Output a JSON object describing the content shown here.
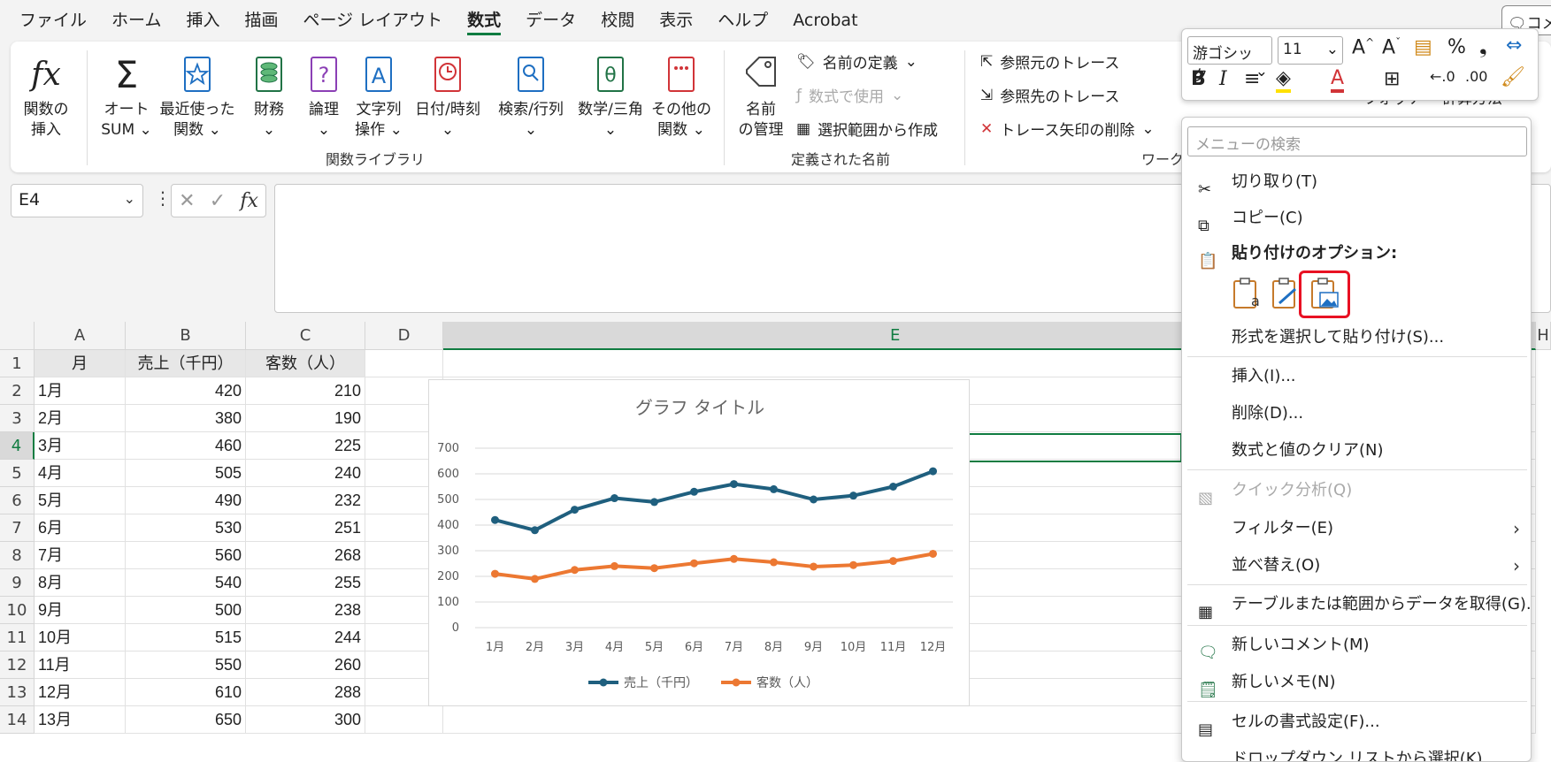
{
  "tabs": [
    "ファイル",
    "ホーム",
    "挿入",
    "描画",
    "ページ レイアウト",
    "数式",
    "データ",
    "校閲",
    "表示",
    "ヘルプ",
    "Acrobat"
  ],
  "active_tab": "数式",
  "comment_button": "コメ",
  "ribbon": {
    "insert_function": [
      "関数の",
      "挿入"
    ],
    "autosum": [
      "オート",
      "SUM ⌄"
    ],
    "recent": [
      "最近使った",
      "関数 ⌄"
    ],
    "financial": [
      "財務",
      "⌄"
    ],
    "logical": [
      "論理",
      "⌄"
    ],
    "text": [
      "文字列",
      "操作 ⌄"
    ],
    "datetime": [
      "日付/時刻",
      "⌄"
    ],
    "lookup": [
      "検索/行列",
      "⌄"
    ],
    "math": [
      "数学/三角",
      "⌄"
    ],
    "more": [
      "その他の",
      "関数 ⌄"
    ],
    "group_function_library": "関数ライブラリ",
    "name_manager": [
      "名前",
      "の管理"
    ],
    "define_name": "名前の定義",
    "use_in_formula": "数式で使用",
    "create_from_selection": "選択範囲から作成",
    "group_defined_names": "定義された名前",
    "trace_precedents": "参照元のトレース",
    "trace_dependents": "参照先のトレース",
    "remove_arrows": "トレース矢印の削除",
    "group_audit": "ワーク",
    "watch": "ウォッチ",
    "calc_options": "計算方法"
  },
  "namebox": "E4",
  "grid": {
    "col_headers": [
      "A",
      "B",
      "C",
      "D",
      "E",
      "H"
    ],
    "row_headers": [
      "1",
      "2",
      "3",
      "4",
      "5",
      "6",
      "7",
      "8",
      "9",
      "10",
      "11",
      "12",
      "13",
      "14"
    ],
    "header_row": [
      "月",
      "売上（千円）",
      "客数（人）"
    ],
    "rows": [
      [
        "1月",
        "420",
        "210"
      ],
      [
        "2月",
        "380",
        "190"
      ],
      [
        "3月",
        "460",
        "225"
      ],
      [
        "4月",
        "505",
        "240"
      ],
      [
        "5月",
        "490",
        "232"
      ],
      [
        "6月",
        "530",
        "251"
      ],
      [
        "7月",
        "560",
        "268"
      ],
      [
        "8月",
        "540",
        "255"
      ],
      [
        "9月",
        "500",
        "238"
      ],
      [
        "10月",
        "515",
        "244"
      ],
      [
        "11月",
        "550",
        "260"
      ],
      [
        "12月",
        "610",
        "288"
      ],
      [
        "13月",
        "650",
        "300"
      ]
    ]
  },
  "chart_data": {
    "type": "line",
    "title": "グラフ タイトル",
    "categories": [
      "1月",
      "2月",
      "3月",
      "4月",
      "5月",
      "6月",
      "7月",
      "8月",
      "9月",
      "10月",
      "11月",
      "12月"
    ],
    "ylim": [
      0,
      700
    ],
    "yticks": [
      0,
      100,
      200,
      300,
      400,
      500,
      600,
      700
    ],
    "grid": true,
    "legend": "bottom",
    "series": [
      {
        "name": "売上（千円）",
        "color": "#1f5f7e",
        "values": [
          420,
          380,
          460,
          505,
          490,
          530,
          560,
          540,
          500,
          515,
          550,
          610
        ]
      },
      {
        "name": "客数（人）",
        "color": "#ec7832",
        "values": [
          210,
          190,
          225,
          240,
          232,
          251,
          268,
          255,
          238,
          244,
          260,
          288
        ]
      }
    ]
  },
  "mini_toolbar": {
    "font": "游ゴシック",
    "size": "11"
  },
  "context_menu": {
    "search_placeholder": "メニューの検索",
    "cut": "切り取り(T)",
    "copy": "コピー(C)",
    "paste_options": "貼り付けのオプション:",
    "paste_special": "形式を選択して貼り付け(S)...",
    "insert": "挿入(I)...",
    "delete": "削除(D)...",
    "clear": "数式と値のクリア(N)",
    "quick_analysis": "クイック分析(Q)",
    "filter": "フィルター(E)",
    "sort": "並べ替え(O)",
    "get_data": "テーブルまたは範囲からデータを取得(G)...",
    "new_comment": "新しいコメント(M)",
    "new_note": "新しいメモ(N)",
    "format_cells": "セルの書式設定(F)...",
    "dropdown": "ドロップダウン リストから選択(K)..."
  }
}
